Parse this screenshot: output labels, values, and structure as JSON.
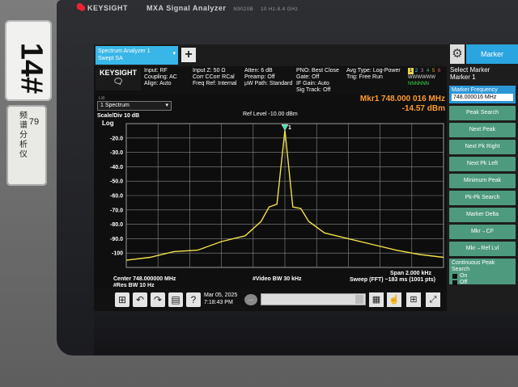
{
  "device": {
    "brand": "KEYSIGHT",
    "model": "MXA Signal Analyzer",
    "model_number": "N9020B",
    "freq_range": "10 Hz-8.4 GHz"
  },
  "stickers": {
    "label_number": "14#",
    "cn_text": "频谱分析仪",
    "id_number": "79"
  },
  "top_tab": {
    "line1": "Spectrum Analyzer 1",
    "line2": "Swept SA",
    "add_label": "+",
    "marker_tab_label": "Marker"
  },
  "info": {
    "logo": "KEYSIGHT",
    "input": [
      "Input: RF",
      "Coupling: AC",
      "Align: Auto"
    ],
    "impedance": [
      "Input Z: 50 Ω",
      "Corr CCorr RCal",
      "Freq Ref: Internal"
    ],
    "atten": [
      "Atten: 6 dB",
      "Preamp: Off",
      "µW Path: Standard"
    ],
    "pno": [
      "PNO: Best Close",
      "Gate: Off",
      "IF Gain: Auto",
      "Sig Track: Off"
    ],
    "avg": [
      "Avg Type: Log-Power",
      "Trig: Free Run"
    ],
    "trace_nums": [
      "1",
      "2",
      "3",
      "4",
      "5",
      "6"
    ],
    "trace_type_row": "WWWWWW",
    "trace_det_row": "NNNNNN"
  },
  "side_panel": {
    "title_line1": "Select Marker",
    "title_line2": "Marker 1",
    "marker_freq_label": "Marker Frequency",
    "marker_freq_value": "748.000016 MHz",
    "buttons": [
      "Peak Search",
      "Next Peak",
      "Next Pk Right",
      "Next Pk Left",
      "Minimum Peak",
      "Pk-Pk Search",
      "Marker Delta",
      "Mkr→CF",
      "Mkr→Ref Lvl"
    ],
    "continuous_label": "Continuous Peak Search",
    "on_label": "On",
    "off_label": "Off"
  },
  "graph": {
    "lxi_label": "LXI",
    "view_select": "1 Spectrum",
    "marker_readout_line1": "Mkr1  748.000 016 MHz",
    "marker_readout_line2": "-14.57 dBm",
    "scale_label": "Scale/Div 10 dB",
    "ref_level_label": "Ref Level -10.00 dBm",
    "log_label": "Log",
    "marker_flag": "1",
    "center_label": "Center 748.000000 MHz",
    "res_bw_label": "#Res BW 10 Hz",
    "video_bw_label": "#Video BW 30 kHz",
    "span_label": "Span 2.000 kHz",
    "sweep_label": "Sweep (FFT) ~183 ms (1001 pts)"
  },
  "taskbar": {
    "date": "Mar 05, 2025",
    "time": "7:18:43 PM",
    "help": "?"
  },
  "colors": {
    "trace": "#f0e04a",
    "marker_readout": "#ff9b2f",
    "accent": "#2aa5e0",
    "softkey": "#4e9a7f"
  },
  "chart_data": {
    "type": "line",
    "title": "",
    "xlabel": "",
    "ylabel": "",
    "y_ticks": [
      "-20.0",
      "-30.0",
      "-40.0",
      "-50.0",
      "-60.0",
      "-70.0",
      "-80.0",
      "-90.0",
      "-100"
    ],
    "ylim": [
      -110,
      -10
    ],
    "xlim": [
      747.999,
      748.001
    ],
    "grid": true,
    "series": [
      {
        "x": [
          747.999,
          747.99915,
          747.9993,
          747.99945,
          747.9996,
          747.99975,
          747.99985,
          747.9999,
          747.99995,
          748.0,
          748.00005,
          748.0001,
          748.00015,
          748.00025,
          748.0004,
          748.00055,
          748.0007,
          748.00085,
          748.001
        ],
        "values": [
          -105,
          -103,
          -99,
          -98,
          -92,
          -88,
          -78,
          -68,
          -66,
          -14.6,
          -68,
          -69,
          -78,
          -86,
          -90,
          -94,
          -98,
          -101,
          -103
        ]
      }
    ]
  }
}
